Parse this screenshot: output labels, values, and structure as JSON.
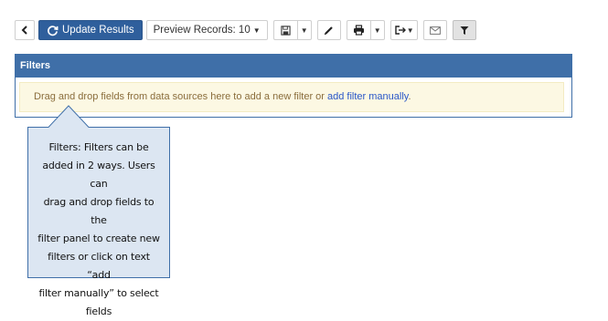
{
  "toolbar": {
    "update_label": "Update Results",
    "preview_label": "Preview Records: 10",
    "icons": {
      "back": "chevron-left-icon",
      "refresh": "refresh-icon",
      "save": "save-icon",
      "edit": "pencil-icon",
      "print": "print-icon",
      "export": "export-icon",
      "email": "email-icon",
      "filter": "filter-icon"
    }
  },
  "filters": {
    "header": "Filters",
    "drop_text": "Drag and drop fields from data sources here to add a new filter or ",
    "drop_link": "add filter manually",
    "drop_end": "."
  },
  "callout": {
    "lines": [
      "Filters: Filters can be",
      "added in 2 ways. Users can",
      "drag and drop fields to the",
      "filter panel to create new",
      "filters or click on text “add",
      "filter manually” to select",
      "fields"
    ]
  },
  "colors": {
    "primary": "#2f5f9c",
    "panel_header": "#3f6fa8",
    "drop_zone_bg": "#fcf8e3",
    "link": "#2a57c8",
    "callout_bg": "#dce6f2",
    "callout_border": "#3f6fa8"
  }
}
